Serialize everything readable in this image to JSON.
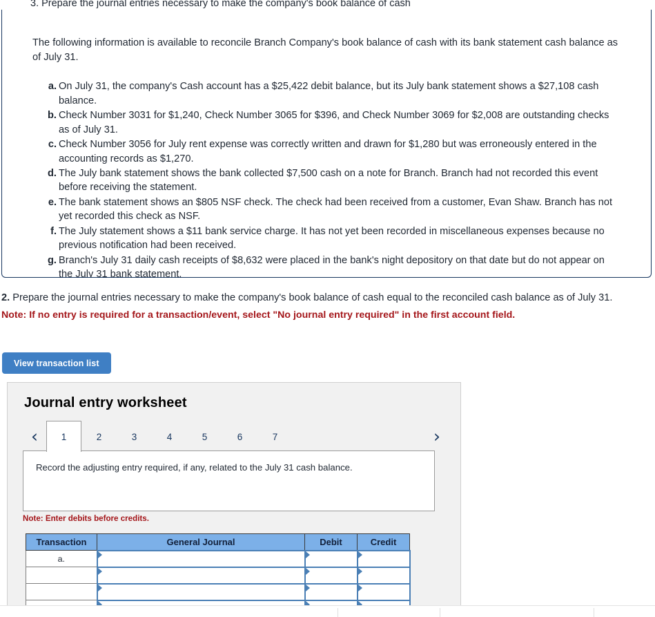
{
  "top_cut_text": "3. Prepare the journal entries necessary to make the company's book balance of cash",
  "question": {
    "intro": "The following information is available to reconcile Branch Company's book balance of cash with its bank statement cash balance as of July 31.",
    "facts": [
      {
        "label": "a.",
        "text": "On July 31, the company's Cash account has a $25,422 debit balance, but its July bank statement shows a $27,108 cash balance."
      },
      {
        "label": "b.",
        "text": "Check Number 3031 for $1,240, Check Number 3065 for $396, and Check Number 3069 for $2,008 are outstanding checks as of July 31."
      },
      {
        "label": "c.",
        "text": "Check Number 3056 for July rent expense was correctly written and drawn for $1,280 but was erroneously entered in the accounting records as $1,270."
      },
      {
        "label": "d.",
        "text": "The July bank statement shows the bank collected $7,500 cash on a note for Branch. Branch had not recorded this event before receiving the statement."
      },
      {
        "label": "e.",
        "text": "The bank statement shows an $805 NSF check. The check had been received from a customer, Evan Shaw. Branch has not yet recorded this check as NSF."
      },
      {
        "label": "f.",
        "text": "The July statement shows a $11 bank service charge. It has not yet been recorded in miscellaneous expenses because no previous notification had been received."
      },
      {
        "label": "g.",
        "text": "Branch's July 31 daily cash receipts of $8,632 were placed in the bank's night depository on that date but do not appear on the July 31 bank statement."
      }
    ]
  },
  "requirement": {
    "number": "2.",
    "text": "Prepare the journal entries necessary to make the company's book balance of cash equal to the reconciled cash balance as of July 31.",
    "note": "Note: If no entry is required for a transaction/event, select \"No journal entry required\" in the first account field."
  },
  "toolbar": {
    "view_transaction_list_label": "View transaction list"
  },
  "worksheet": {
    "title": "Journal entry worksheet",
    "prev_arrow": "‹",
    "next_arrow": "›",
    "tabs": [
      {
        "label": "1",
        "active": true
      },
      {
        "label": "2",
        "active": false
      },
      {
        "label": "3",
        "active": false
      },
      {
        "label": "4",
        "active": false
      },
      {
        "label": "5",
        "active": false
      },
      {
        "label": "6",
        "active": false
      },
      {
        "label": "7",
        "active": false
      }
    ],
    "description": "Record the adjusting entry required, if any, related to the July 31 cash balance.",
    "subnote": "Note: Enter debits before credits.",
    "table": {
      "headers": [
        "Transaction",
        "General Journal",
        "Debit",
        "Credit"
      ],
      "rows": [
        {
          "transaction": "a.",
          "general_journal": "",
          "debit": "",
          "credit": ""
        },
        {
          "transaction": "",
          "general_journal": "",
          "debit": "",
          "credit": ""
        },
        {
          "transaction": "",
          "general_journal": "",
          "debit": "",
          "credit": ""
        },
        {
          "transaction": "",
          "general_journal": "",
          "debit": "",
          "credit": ""
        }
      ]
    }
  },
  "colors": {
    "accent_blue": "#3f7fc4",
    "header_blue": "#7cb0e8",
    "note_red": "#a4161a",
    "panel_border": "#16355e",
    "input_border": "#4a7fb5"
  }
}
